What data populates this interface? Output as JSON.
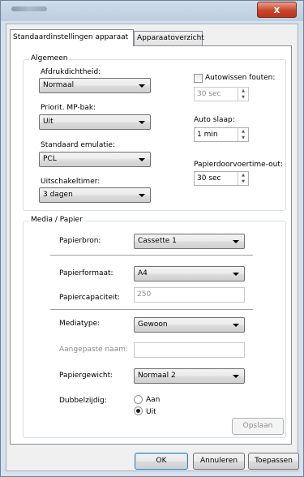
{
  "window": {
    "close_glyph": "x"
  },
  "tabs": [
    {
      "label": "Standaardinstellingen apparaat"
    },
    {
      "label": "Apparaatoverzicht"
    }
  ],
  "algemeen": {
    "title": "Algemeen",
    "afdrukdichtheid": {
      "label": "Afdrukdichtheid:",
      "value": "Normaal"
    },
    "priorit_mp_bak": {
      "label": "Priorit. MP-bak:",
      "value": "Uit"
    },
    "standaard_emulatie": {
      "label": "Standaard emulatie:",
      "value": "PCL"
    },
    "uitschakeltimer": {
      "label": "Uitschakeltimer:",
      "value": "3 dagen"
    },
    "autowissen": {
      "label": "Autowissen fouten:",
      "checked": false,
      "value": "30 sec"
    },
    "auto_slaap": {
      "label": "Auto slaap:",
      "value": "1 min"
    },
    "papierdoorvoer": {
      "label": "Papierdoorvoertime-out:",
      "value": "30 sec"
    }
  },
  "media": {
    "title": "Media / Papier",
    "papierbron": {
      "label": "Papierbron:",
      "value": "Cassette 1"
    },
    "papierformaat": {
      "label": "Papierformaat:",
      "value": "A4"
    },
    "papiercapaciteit": {
      "label": "Papiercapaciteit:",
      "value": "250"
    },
    "mediatype": {
      "label": "Mediatype:",
      "value": "Gewoon"
    },
    "aangepaste_naam": {
      "label": "Aangepaste naam:",
      "value": ""
    },
    "papiergewicht": {
      "label": "Papiergewicht:",
      "value": "Normaal 2"
    },
    "dubbelzijdig": {
      "label": "Dubbelzijdig:",
      "options": [
        "Aan",
        "Uit"
      ],
      "selected": "Uit"
    },
    "opslaan_label": "Opslaan"
  },
  "footer": {
    "ok": "OK",
    "annuleren": "Annuleren",
    "toepassen": "Toepassen"
  }
}
